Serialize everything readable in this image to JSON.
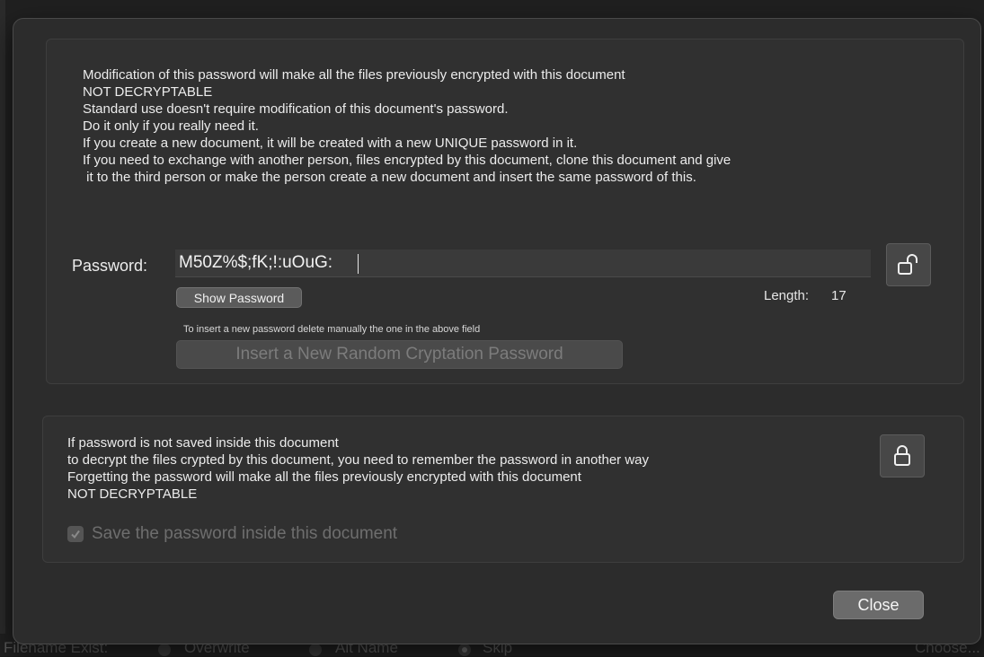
{
  "window": {
    "background_app": {
      "filename_exist_label": "Filename Exist:",
      "options": [
        "Overwrite",
        "Alt Name",
        "Skip"
      ],
      "selected_option": "Skip",
      "right_button": "Choose..."
    }
  },
  "password_section": {
    "warning_lines": [
      "Modification of this password will make all the files previously encrypted with this document",
      "NOT DECRYPTABLE",
      "Standard use doesn't require modification of this document's password.",
      "Do it only if you really need it.",
      "If you create a new document, it will be created with a new UNIQUE password in it.",
      "If you need to exchange with another person, files encrypted by this document, clone this document and give",
      " it to the third person or make the person create a new document and insert the same password of this."
    ],
    "password_label": "Password:",
    "password_value": "M50Z%$;fK;!:uOuG:",
    "lock_icon_open": "unlock-icon",
    "show_password_label": "Show Password",
    "length_label": "Length:",
    "length_value": "17",
    "hint": "To insert a new password delete manually the one in the above field",
    "random_button_label": "Insert a New Random Cryptation Password"
  },
  "save_section": {
    "info_lines": [
      "If password is not saved inside this document",
      "to decrypt the files crypted by this document, you need to remember the password in another way",
      "Forgetting the password will make all the files previously encrypted with this document",
      "NOT DECRYPTABLE"
    ],
    "lock_icon_closed": "lock-icon",
    "save_checkbox_checked": true,
    "save_checkbox_label": "Save the password inside this document"
  },
  "footer": {
    "close_label": "Close"
  },
  "colors": {
    "sheet_bg": "#2c2c2c",
    "box_bg": "#303030",
    "text": "#ececec",
    "disabled_text": "#6e6e6e"
  }
}
